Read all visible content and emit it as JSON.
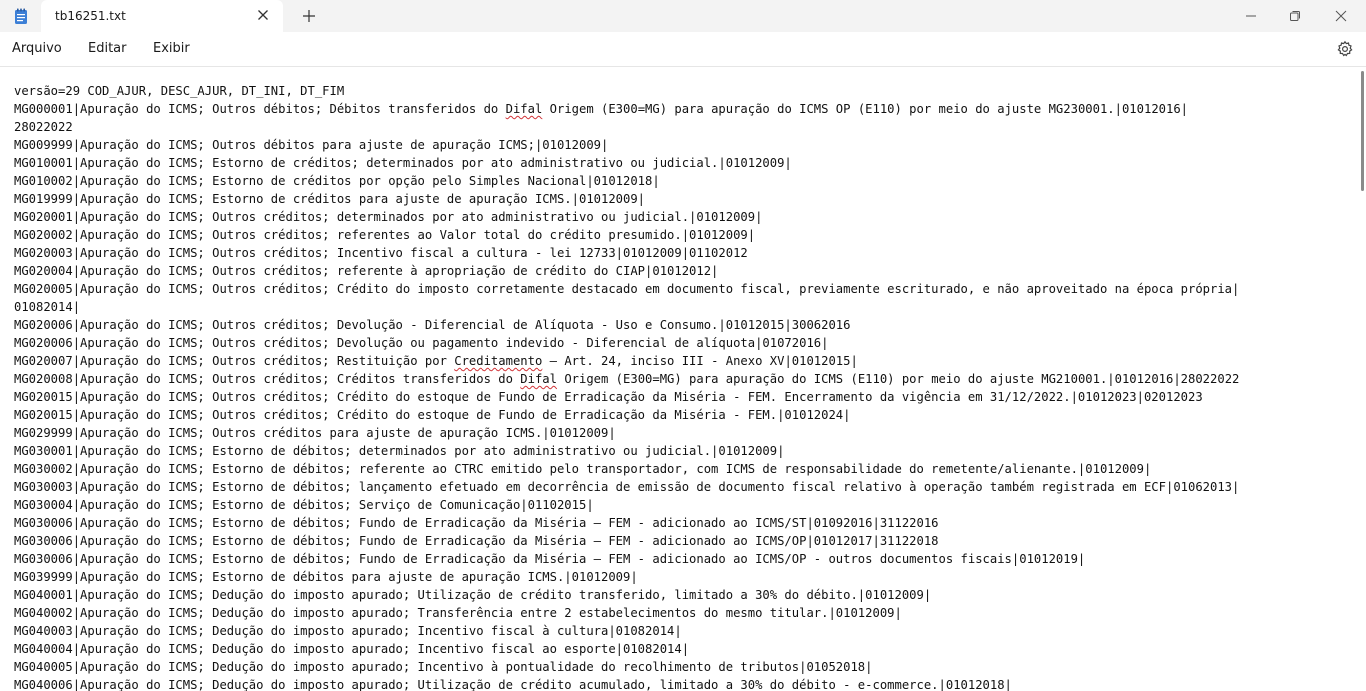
{
  "window": {
    "tab_title": "tb16251.txt",
    "icons": {
      "app": "notepad-icon",
      "tab_close": "close-icon",
      "new_tab": "plus-icon",
      "minimize": "minimize-icon",
      "maximize": "restore-icon",
      "close": "close-icon",
      "settings": "gear-icon"
    }
  },
  "menu": {
    "items": [
      {
        "label": "Arquivo"
      },
      {
        "label": "Editar"
      },
      {
        "label": "Exibir"
      }
    ]
  },
  "editor": {
    "spell_words": [
      "Difal",
      "Creditamento"
    ],
    "lines": [
      "versão=29 COD_AJUR, DESC_AJUR, DT_INI, DT_FIM",
      "MG000001|Apuração do ICMS; Outros débitos; Débitos transferidos do Difal Origem (E300=MG) para apuração do ICMS OP (E110) por meio do ajuste MG230001.|01012016|",
      "28022022",
      "MG009999|Apuração do ICMS; Outros débitos para ajuste de apuração ICMS;|01012009|",
      "MG010001|Apuração do ICMS; Estorno de créditos; determinados por ato administrativo ou judicial.|01012009|",
      "MG010002|Apuração do ICMS; Estorno de créditos por opção pelo Simples Nacional|01012018|",
      "MG019999|Apuração do ICMS; Estorno de créditos para ajuste de apuração ICMS.|01012009|",
      "MG020001|Apuração do ICMS; Outros créditos; determinados por ato administrativo ou judicial.|01012009|",
      "MG020002|Apuração do ICMS; Outros créditos; referentes ao Valor total do crédito presumido.|01012009|",
      "MG020003|Apuração do ICMS; Outros créditos; Incentivo fiscal a cultura - lei 12733|01012009|01102012",
      "MG020004|Apuração do ICMS; Outros créditos; referente à apropriação de crédito do CIAP|01012012|",
      "MG020005|Apuração do ICMS; Outros créditos; Crédito do imposto corretamente destacado em documento fiscal, previamente escriturado, e não aproveitado na época própria|",
      "01082014|",
      "MG020006|Apuração do ICMS; Outros créditos; Devolução - Diferencial de Alíquota - Uso e Consumo.|01012015|30062016",
      "MG020006|Apuração do ICMS; Outros créditos; Devolução ou pagamento indevido - Diferencial de alíquota|01072016|",
      "MG020007|Apuração do ICMS; Outros créditos; Restituição por Creditamento – Art. 24, inciso III - Anexo XV|01012015|",
      "MG020008|Apuração do ICMS; Outros créditos; Créditos transferidos do Difal Origem (E300=MG) para apuração do ICMS (E110) por meio do ajuste MG210001.|01012016|28022022",
      "MG020015|Apuração do ICMS; Outros créditos; Crédito do estoque de Fundo de Erradicação da Miséria - FEM. Encerramento da vigência em 31/12/2022.|01012023|02012023",
      "MG020015|Apuração do ICMS; Outros créditos; Crédito do estoque de Fundo de Erradicação da Miséria - FEM.|01012024|",
      "MG029999|Apuração do ICMS; Outros créditos para ajuste de apuração ICMS.|01012009|",
      "MG030001|Apuração do ICMS; Estorno de débitos; determinados por ato administrativo ou judicial.|01012009|",
      "MG030002|Apuração do ICMS; Estorno de débitos; referente ao CTRC emitido pelo transportador, com ICMS de responsabilidade do remetente/alienante.|01012009|",
      "MG030003|Apuração do ICMS; Estorno de débitos; lançamento efetuado em decorrência de emissão de documento fiscal relativo à operação também registrada em ECF|01062013|",
      "MG030004|Apuração do ICMS; Estorno de débitos; Serviço de Comunicação|01102015|",
      "MG030006|Apuração do ICMS; Estorno de débitos; Fundo de Erradicação da Miséria – FEM - adicionado ao ICMS/ST|01092016|31122016",
      "MG030006|Apuração do ICMS; Estorno de débitos; Fundo de Erradicação da Miséria – FEM - adicionado ao ICMS/OP|01012017|31122018",
      "MG030006|Apuração do ICMS; Estorno de débitos; Fundo de Erradicação da Miséria – FEM - adicionado ao ICMS/OP - outros documentos fiscais|01012019|",
      "MG039999|Apuração do ICMS; Estorno de débitos para ajuste de apuração ICMS.|01012009|",
      "MG040001|Apuração do ICMS; Dedução do imposto apurado; Utilização de crédito transferido, limitado a 30% do débito.|01012009|",
      "MG040002|Apuração do ICMS; Dedução do imposto apurado; Transferência entre 2 estabelecimentos do mesmo titular.|01012009|",
      "MG040003|Apuração do ICMS; Dedução do imposto apurado; Incentivo fiscal à cultura|01082014|",
      "MG040004|Apuração do ICMS; Dedução do imposto apurado; Incentivo fiscal ao esporte|01082014|",
      "MG040005|Apuração do ICMS; Dedução do imposto apurado; Incentivo à pontualidade do recolhimento de tributos|01052018|",
      "MG040006|Apuração do ICMS; Dedução do imposto apurado; Utilização de crédito acumulado, limitado a 30% do débito - e-commerce.|01012018|"
    ]
  }
}
